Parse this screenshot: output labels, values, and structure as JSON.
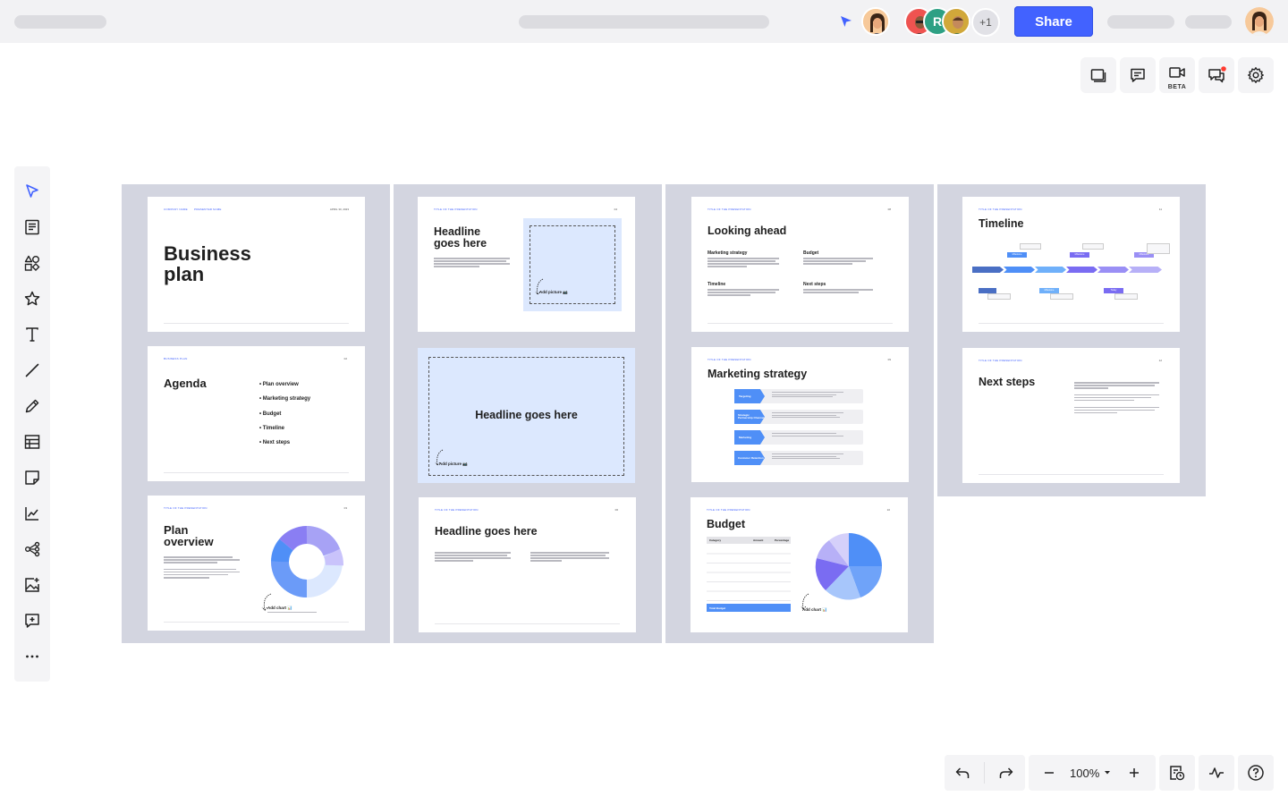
{
  "toolbar": {
    "share_label": "Share",
    "extra_collaborators": "+1",
    "collab_initial": "R"
  },
  "right_tools": {
    "beta_badge": "BETA"
  },
  "left_tools": [
    "cursor-icon",
    "templates-icon",
    "shapes-icon",
    "star-icon",
    "text-icon",
    "line-icon",
    "pen-icon",
    "table-icon",
    "sticky-note-icon",
    "chart-icon",
    "mindmap-icon",
    "image-icon",
    "comment-add-icon",
    "more-icon"
  ],
  "zoom": {
    "level": "100%"
  },
  "colors": {
    "accent": "#4262ff",
    "frame": "#d3d5e0",
    "slide_blue": "#dce8fe"
  },
  "slides": {
    "business": {
      "company": "COMPANY NAME",
      "presenter": "PRESENTER NAME",
      "date": "APRIL 30, 2023",
      "title_line1": "Business",
      "title_line2": "plan"
    },
    "agenda": {
      "tag": "BUSINESS PLAN",
      "page": "02",
      "title": "Agenda",
      "items": [
        "• Plan overview",
        "• Marketing strategy",
        "• Budget",
        "• Timeline",
        "• Next steps"
      ]
    },
    "plan": {
      "tag": "TITLE OF THE PRESENTATION",
      "page": "03",
      "title_line1": "Plan",
      "title_line2": "overview",
      "add_chart": "Add chart 📊"
    },
    "headline_pic": {
      "tag": "TITLE OF THE PRESENTATION",
      "page": "04",
      "title_line1": "Headline",
      "title_line2": "goes here",
      "add_picture": "Add picture 📷"
    },
    "headline_blue": {
      "title": "Headline goes here",
      "add_picture": "Add picture 📷"
    },
    "headline_text": {
      "tag": "TITLE OF THE PRESENTATION",
      "page": "06",
      "title": "Headline goes here"
    },
    "looking": {
      "tag": "TITLE OF THE PRESENTATION",
      "page": "08",
      "title": "Looking ahead",
      "sections": [
        "Marketing strategy",
        "Budget",
        "Timeline",
        "Next steps"
      ]
    },
    "marketing": {
      "tag": "TITLE OF THE PRESENTATION",
      "page": "09",
      "title": "Marketing strategy",
      "stages": [
        "Targeting",
        "Strategic Partnership Channel",
        "Marketing",
        "Customer Retention"
      ]
    },
    "budget": {
      "tag": "TITLE OF THE PRESENTATION",
      "page": "10",
      "title": "Budget",
      "table_headers": [
        "Category",
        "Amount",
        "Percentage"
      ],
      "total_label": "Total Budget",
      "add_chart": "Add chart 📊"
    },
    "timeline": {
      "tag": "TITLE OF THE PRESENTATION",
      "page": "11",
      "title": "Timeline",
      "markers": [
        "Milestone",
        "Milestone",
        "Milestone",
        "Milestone",
        "Today"
      ]
    },
    "next": {
      "tag": "TITLE OF THE PRESENTATION",
      "page": "12",
      "title": "Next steps"
    }
  }
}
